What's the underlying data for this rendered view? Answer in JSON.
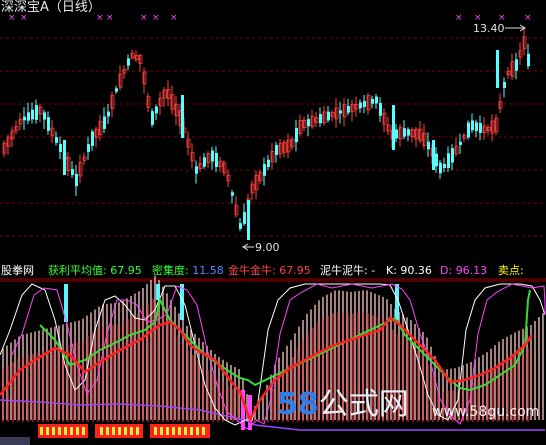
{
  "header": {
    "title": "深深宝A（日线）"
  },
  "price_panel": {
    "high_label": "13.40",
    "low_label": "9.00",
    "colors": {
      "up": "#ff4040",
      "down": "#54ffff",
      "marker": "#ff44ff",
      "grid": "#7a0000"
    }
  },
  "indicator_bar": {
    "logo": "股拳网",
    "items": [
      {
        "label": "获利平均值:",
        "value": "67.95",
        "label_color": "#33ff33",
        "value_color": "#33ff33"
      },
      {
        "label": "密集度:",
        "value": "11.58",
        "label_color": "#33ff33",
        "value_color": "#5588ff"
      },
      {
        "label": "金牛金牛:",
        "value": "67.95",
        "label_color": "#ff4444",
        "value_color": "#ff4444"
      },
      {
        "label": "泥牛泥牛:",
        "value": "-",
        "label_color": "#ffffff",
        "value_color": "#ffffff"
      },
      {
        "label": "K:",
        "value": "90.36",
        "label_color": "#ffffff",
        "value_color": "#ffffff"
      },
      {
        "label": "D:",
        "value": "96.13",
        "label_color": "#ff44ff",
        "value_color": "#ff44ff"
      },
      {
        "label": "卖点:",
        "value": "",
        "label_color": "#ffff00",
        "value_color": "#ffff00"
      }
    ]
  },
  "watermark": {
    "brand_num": "58",
    "brand_cn": "公式网",
    "url": "www.58gu.com"
  }
}
